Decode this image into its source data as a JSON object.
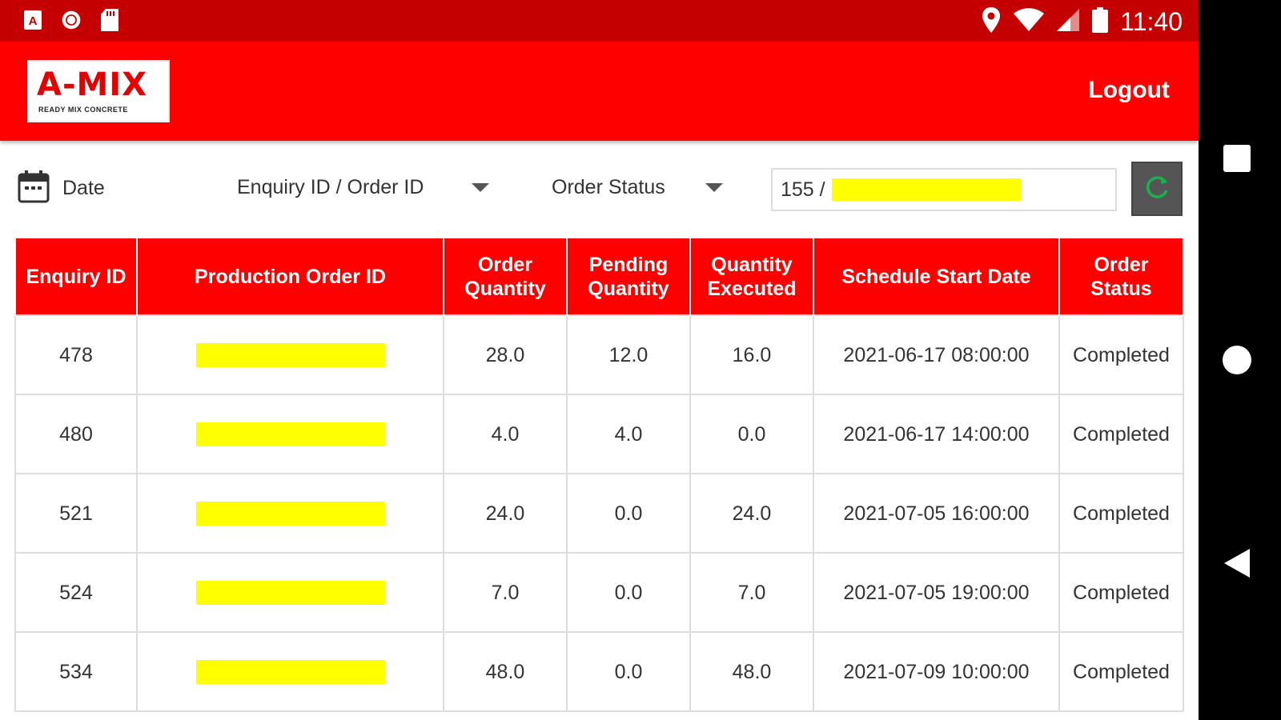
{
  "status_bar": {
    "time": "11:40"
  },
  "header": {
    "logo_text": "A-MIX",
    "logo_subtext": "READY MIX CONCRETE",
    "logout_label": "Logout"
  },
  "filters": {
    "date_label": "Date",
    "enquiry_dropdown_label": "Enquiry ID / Order ID",
    "status_dropdown_label": "Order Status",
    "search_value": "155 /"
  },
  "table": {
    "headers": {
      "enquiry_id": "Enquiry ID",
      "production_order_id": "Production Order ID",
      "order_quantity": "Order Quantity",
      "pending_quantity": "Pending Quantity",
      "quantity_executed": "Quantity Executed",
      "schedule_start_date": "Schedule Start Date",
      "order_status": "Order Status"
    },
    "rows": [
      {
        "enquiry_id": "478",
        "order_quantity": "28.0",
        "pending_quantity": "12.0",
        "quantity_executed": "16.0",
        "schedule_start_date": "2021-06-17 08:00:00",
        "order_status": "Completed"
      },
      {
        "enquiry_id": "480",
        "order_quantity": "4.0",
        "pending_quantity": "4.0",
        "quantity_executed": "0.0",
        "schedule_start_date": "2021-06-17 14:00:00",
        "order_status": "Completed"
      },
      {
        "enquiry_id": "521",
        "order_quantity": "24.0",
        "pending_quantity": "0.0",
        "quantity_executed": "24.0",
        "schedule_start_date": "2021-07-05 16:00:00",
        "order_status": "Completed"
      },
      {
        "enquiry_id": "524",
        "order_quantity": "7.0",
        "pending_quantity": "0.0",
        "quantity_executed": "7.0",
        "schedule_start_date": "2021-07-05 19:00:00",
        "order_status": "Completed"
      },
      {
        "enquiry_id": "534",
        "order_quantity": "48.0",
        "pending_quantity": "0.0",
        "quantity_executed": "48.0",
        "schedule_start_date": "2021-07-09 10:00:00",
        "order_status": "Completed"
      }
    ]
  },
  "colors": {
    "status_bar": "#c40000",
    "app_bar": "#ff0000",
    "table_header": "#ff0000",
    "redaction": "#ffff00",
    "refresh_icon": "#19b24a"
  },
  "icons": {
    "status_left": [
      "a-notification-icon",
      "record-icon",
      "sd-card-icon"
    ],
    "status_right": [
      "location-icon",
      "wifi-icon",
      "cell-signal-icon",
      "battery-icon"
    ],
    "filters": [
      "calendar-icon",
      "chevron-down-icon",
      "refresh-icon"
    ],
    "nav": [
      "recents-icon",
      "home-icon",
      "back-icon"
    ]
  }
}
